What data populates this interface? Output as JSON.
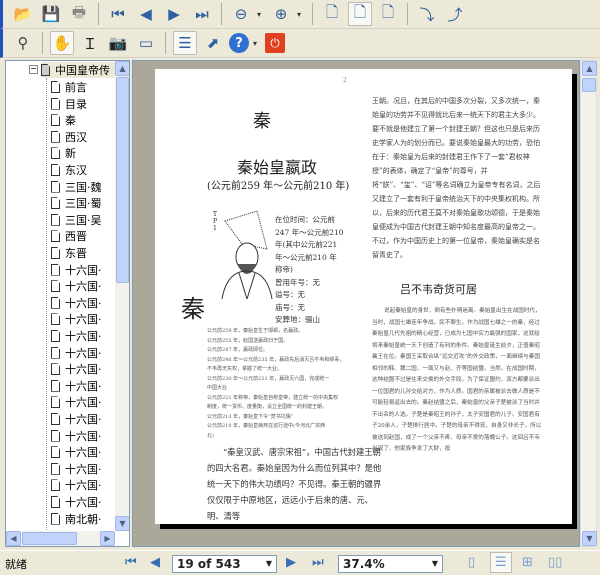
{
  "toolbar1": {
    "items": [
      "open-icon",
      "save-icon",
      "print-icon",
      "first-page-icon",
      "previous-page-icon",
      "next-page-icon",
      "last-page-icon",
      "zoom-out-icon",
      "zoom-in-icon",
      "actual-size-icon",
      "fit-page-icon",
      "fit-width-icon",
      "rotate-clockwise-icon",
      "rotate-counterclockwise-icon"
    ]
  },
  "toolbar2": {
    "items": [
      "find-icon",
      "hand-tool-icon",
      "text-select-icon",
      "snapshot-icon",
      "annotate-icon",
      "bookmarks-panel-icon",
      "fullscreen-icon",
      "help-icon",
      "exit-icon"
    ]
  },
  "tree": {
    "root": "中国皇帝传",
    "items": [
      "前言",
      "目录",
      "秦",
      "西汉",
      "新",
      "东汉",
      "三国·魏",
      "三国·蜀",
      "三国·吴",
      "西晋",
      "东晋",
      "十六国·",
      "十六国·",
      "十六国·",
      "十六国·",
      "十六国·",
      "十六国·",
      "十六国·",
      "十六国·",
      "十六国·",
      "十六国·",
      "十六国·",
      "十六国·",
      "十六国·",
      "十六国·",
      "十六国·",
      "南北朝·"
    ]
  },
  "page": {
    "number": "2",
    "dynasty": "秦",
    "title": "秦始皇嬴政",
    "dates": "(公元前259 年～公元前210 年)",
    "portrait_label": "T P 1",
    "info": [
      "在位时间：公元前",
      "247 年～公元前210",
      "年(其中公元前221",
      "年～公元前210 年",
      "称帝)",
      "曾用年号：无",
      "谥号：无",
      "庙号：无",
      "安葬地：骊山"
    ],
    "side_char": "秦",
    "chronology": [
      "公元前259 年，秦始皇生于邯郸，名赢政。",
      "公元前255 年，赵国送嬴政归于国。",
      "公元前247 年，嬴政即位。",
      "公元前246 年～公元前235 年，嬴政先后消灭吕不韦和缪毒，",
      "不韦再无实权，掌握了统一大业。",
      "公元前230 年～公元前221 年，嬴政灭六国，完成统一",
      "中国大业",
      "公元前221 年称帝，秦始皇自称皇帝，建立统一的中央集权",
      "制度，统一货币、度量衡，设立全国统一的封建王朝。",
      "公元前213 年，秦始皇下令“焚书坑儒”",
      "公元前210 年，秦始皇病死在巡行途中(今河北广宗西",
      "北)"
    ],
    "para_left": "“秦皇汉武、唐宗宋祖”，中国古代封建王朝的四大名君。秦始皇因为什么而位列其中？是他统一天下的伟大功绩吗？不见得。秦王朝的疆界仅仅限于中原地区，远远小于后来的唐、元、明、清等",
    "para_right": "王朝。况且，在其后的中国多次分裂，又多次统一，秦始皇的功劳并不见得就比后来一统天下的君主大多少。要不就是他建立了第一个封建王朝？但这也只是后来历史学家人为的划分而已。要说秦始皇最大的功劳，恐怕在于：秦始皇为后来的封建君王作下了一套“君权神授”的表体，确定了“皇帝”的尊号，并将“朕”、“玺”、“诏”等名词确立为皇帝专有名词，之后又建立了一套有利于皇帝统治天下的中央集权机构。所以，后来的历代君王莫不对秦始皇歌功颂德，于是秦始皇便成为中国古代封建王朝中知名度最高的皇帝之一。不过，作为中国历史上的第一位皇帝，秦始皇确实是名留青史了。",
    "heading2": "吕不韦奇货可居",
    "para_right2": "说起秦始皇的身世，倒有些扑朔迷离。秦始皇出生在战国时代，当时，战国七雄连年争战，民不聊生。作为战国七雄之一的秦，经过秦始皇几代先祖的精心经营，已成为七国中实力最强的国家，这就给将来秦始皇统一天下创造了有利的条件。秦始皇诞生前夕，正值秦昭襄王在位。秦国王采取合纵“远交近攻”的外交政策，一面继续与秦国相邻的韩、魏二国，一面又与赵、齐等国结盟。当然，在战国时期，这种结盟不过是往来交换的外交手段。为了保证盟约，双方都要派出一位国君的儿孙交给对方，作为人质。国君的亲属被派去做人质是不可能轻易返出去的。秦赵结盟之后，秦始皇的父亲子楚被派了当时并不出名的人选。子楚是秦昭王的孙子，太子安国君的儿子。安国君有子20余人，子楚排行居中。子楚的母亲不得宠，自身又非长子，所以被送到赵国，成了一个父亲不疼、母亲不爱的落魄公子。这回吕不韦出现了，他家族争发了大财，投"
  },
  "status": {
    "text": "就绪",
    "page_field": "19 of 543",
    "zoom_field": "37.4%"
  }
}
